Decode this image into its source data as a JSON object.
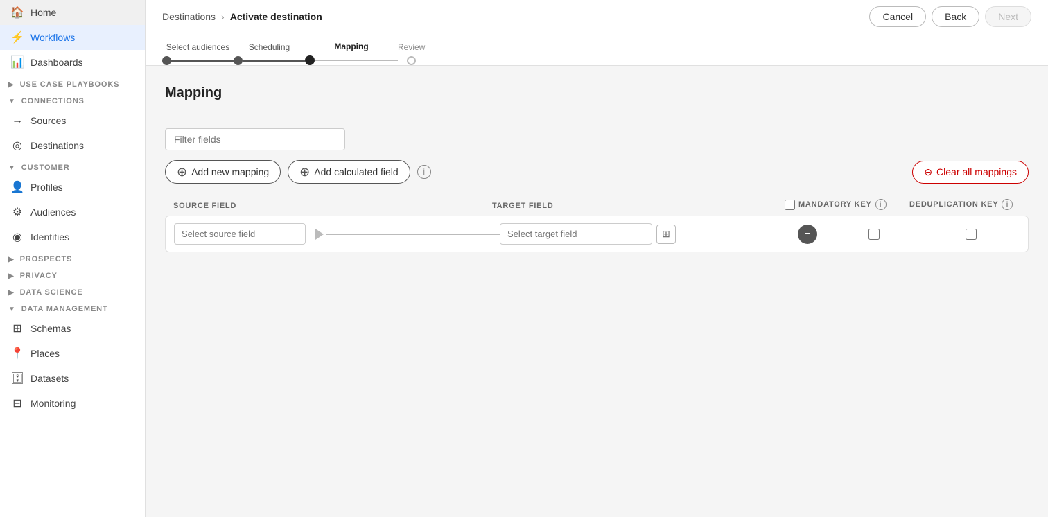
{
  "sidebar": {
    "items": [
      {
        "id": "home",
        "label": "Home",
        "icon": "🏠",
        "active": false
      },
      {
        "id": "workflows",
        "label": "Workflows",
        "icon": "⚡",
        "active": true
      }
    ],
    "sections": [
      {
        "id": "connections",
        "label": "CONNECTIONS",
        "expanded": true,
        "items": [
          {
            "id": "sources",
            "label": "Sources",
            "icon": "→"
          },
          {
            "id": "destinations",
            "label": "Destinations",
            "icon": "◎"
          }
        ]
      },
      {
        "id": "customer",
        "label": "CUSTOMER",
        "expanded": true,
        "items": [
          {
            "id": "profiles",
            "label": "Profiles",
            "icon": "👤"
          },
          {
            "id": "audiences",
            "label": "Audiences",
            "icon": "⚙"
          },
          {
            "id": "identities",
            "label": "Identities",
            "icon": "◉"
          }
        ]
      },
      {
        "id": "prospects",
        "label": "PROSPECTS",
        "expanded": false,
        "items": []
      },
      {
        "id": "privacy",
        "label": "PRIVACY",
        "expanded": false,
        "items": []
      },
      {
        "id": "data-science",
        "label": "DATA SCIENCE",
        "expanded": false,
        "items": []
      },
      {
        "id": "data-management",
        "label": "DATA MANAGEMENT",
        "expanded": true,
        "items": [
          {
            "id": "schemas",
            "label": "Schemas",
            "icon": "⊞"
          },
          {
            "id": "places",
            "label": "Places",
            "icon": "📍"
          },
          {
            "id": "datasets",
            "label": "Datasets",
            "icon": "🗄"
          },
          {
            "id": "monitoring",
            "label": "Monitoring",
            "icon": "⊟"
          }
        ]
      }
    ]
  },
  "header": {
    "breadcrumb": {
      "parent": "Destinations",
      "separator": "›",
      "current": "Activate destination"
    },
    "cancel_label": "Cancel",
    "back_label": "Back",
    "next_label": "Next"
  },
  "stepper": {
    "steps": [
      {
        "label": "Select audiences",
        "state": "done"
      },
      {
        "label": "Scheduling",
        "state": "done"
      },
      {
        "label": "Mapping",
        "state": "active"
      },
      {
        "label": "Review",
        "state": "future"
      }
    ]
  },
  "mapping": {
    "title": "Mapping",
    "filter_placeholder": "Filter fields",
    "add_mapping_label": "Add new mapping",
    "add_calculated_label": "Add calculated field",
    "clear_label": "Clear all mappings",
    "columns": {
      "source": "SOURCE FIELD",
      "target": "TARGET FIELD",
      "mandatory": "MANDATORY KEY",
      "dedup": "DEDUPLICATION KEY"
    },
    "rows": [
      {
        "source_placeholder": "Select source field",
        "target_placeholder": "Select target field",
        "mandatory": false,
        "dedup": false
      }
    ]
  }
}
